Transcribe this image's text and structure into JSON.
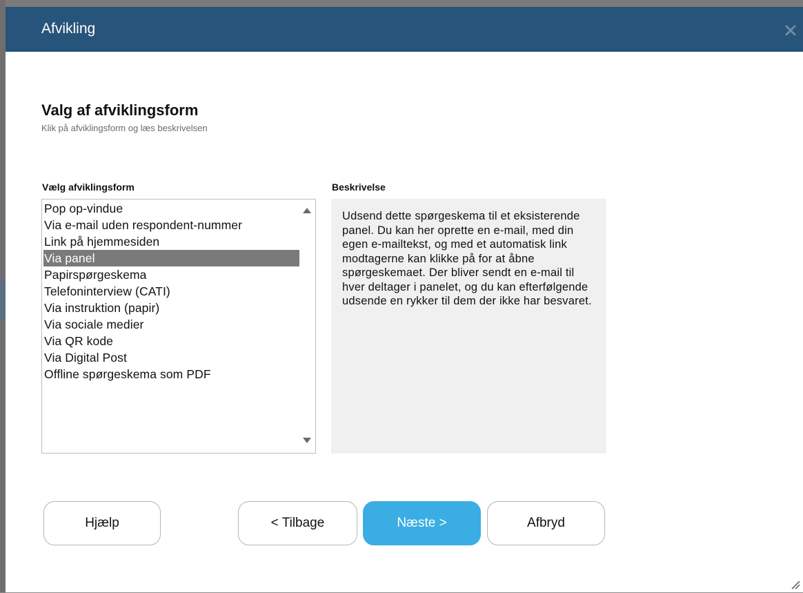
{
  "dialog": {
    "title": "Afvikling",
    "heading": "Valg af afviklingsform",
    "subheading": "Klik på afviklingsform og læs beskrivelsen"
  },
  "list": {
    "label": "Vælg afviklingsform",
    "selected_index": 3,
    "items": [
      "Pop op-vindue",
      "Via e-mail uden respondent-nummer",
      "Link på hjemmesiden",
      "Via panel",
      "Papirspørgeskema",
      "Telefoninterview (CATI)",
      "Via instruktion (papir)",
      "Via sociale medier",
      "Via QR kode",
      "Via Digital Post",
      "Offline spørgeskema som PDF"
    ]
  },
  "description": {
    "label": "Beskrivelse",
    "text": "Udsend dette spørgeskema til et eksisterende panel. Du kan her oprette en e-mail, med din egen e-mailtekst, og med et automatisk link modtagerne kan klikke på for at åbne spørgeskemaet. Der bliver sendt en e-mail til hver deltager i panelet, og du kan efterfølgende udsende en rykker til dem der ikke har besvaret."
  },
  "buttons": {
    "help": "Hjælp",
    "back": "< Tilbage",
    "next": "Næste >",
    "cancel": "Afbryd"
  },
  "colors": {
    "titlebar": "#27547a",
    "accent": "#3aade3",
    "selection": "#7a7a7a"
  },
  "icons": {
    "close": "close-icon",
    "scroll_up": "scroll-up-icon",
    "scroll_down": "scroll-down-icon",
    "resize": "resize-grip-icon"
  }
}
